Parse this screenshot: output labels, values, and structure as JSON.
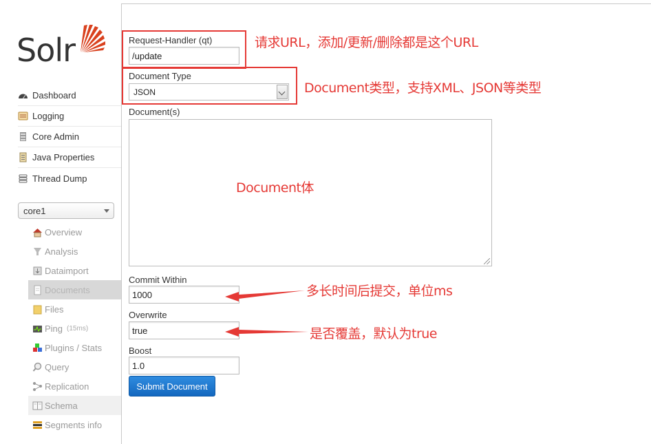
{
  "logo": {
    "text": "Solr"
  },
  "sidebar": {
    "main_items": [
      {
        "label": "Dashboard",
        "icon": "dashboard-icon"
      },
      {
        "label": "Logging",
        "icon": "logging-icon"
      },
      {
        "label": "Core Admin",
        "icon": "core-admin-icon"
      },
      {
        "label": "Java Properties",
        "icon": "java-properties-icon"
      },
      {
        "label": "Thread Dump",
        "icon": "thread-dump-icon"
      }
    ],
    "core_selector": {
      "value": "core1"
    },
    "core_items": [
      {
        "label": "Overview",
        "icon": "home-icon"
      },
      {
        "label": "Analysis",
        "icon": "funnel-icon"
      },
      {
        "label": "Dataimport",
        "icon": "dataimport-icon"
      },
      {
        "label": "Documents",
        "icon": "documents-icon",
        "active": true
      },
      {
        "label": "Files",
        "icon": "folder-icon"
      },
      {
        "label": "Ping",
        "icon": "ping-icon",
        "extra": "(15ms)"
      },
      {
        "label": "Plugins / Stats",
        "icon": "plugins-icon"
      },
      {
        "label": "Query",
        "icon": "magnifier-icon"
      },
      {
        "label": "Replication",
        "icon": "replication-icon"
      },
      {
        "label": "Schema",
        "icon": "schema-icon"
      },
      {
        "label": "Segments info",
        "icon": "segments-icon"
      }
    ]
  },
  "form": {
    "request_handler": {
      "label": "Request-Handler (qt)",
      "value": "/update"
    },
    "document_type": {
      "label": "Document Type",
      "value": "JSON"
    },
    "documents": {
      "label": "Document(s)",
      "value": ""
    },
    "commit_within": {
      "label": "Commit Within",
      "value": "1000"
    },
    "overwrite": {
      "label": "Overwrite",
      "value": "true"
    },
    "boost": {
      "label": "Boost",
      "value": "1.0"
    },
    "submit_label": "Submit Document"
  },
  "annotations": {
    "request_handler": "请求URL，添加/更新/删除都是这个URL",
    "document_type": "Document类型，支持XML、JSON等类型",
    "documents_body": "Document体",
    "commit_within": "多长时间后提交，单位ms",
    "overwrite": "是否覆盖，默认为true",
    "color": "#e53935"
  },
  "colors": {
    "accent_button": "#1a73c8",
    "annotation_red": "#e53935"
  }
}
